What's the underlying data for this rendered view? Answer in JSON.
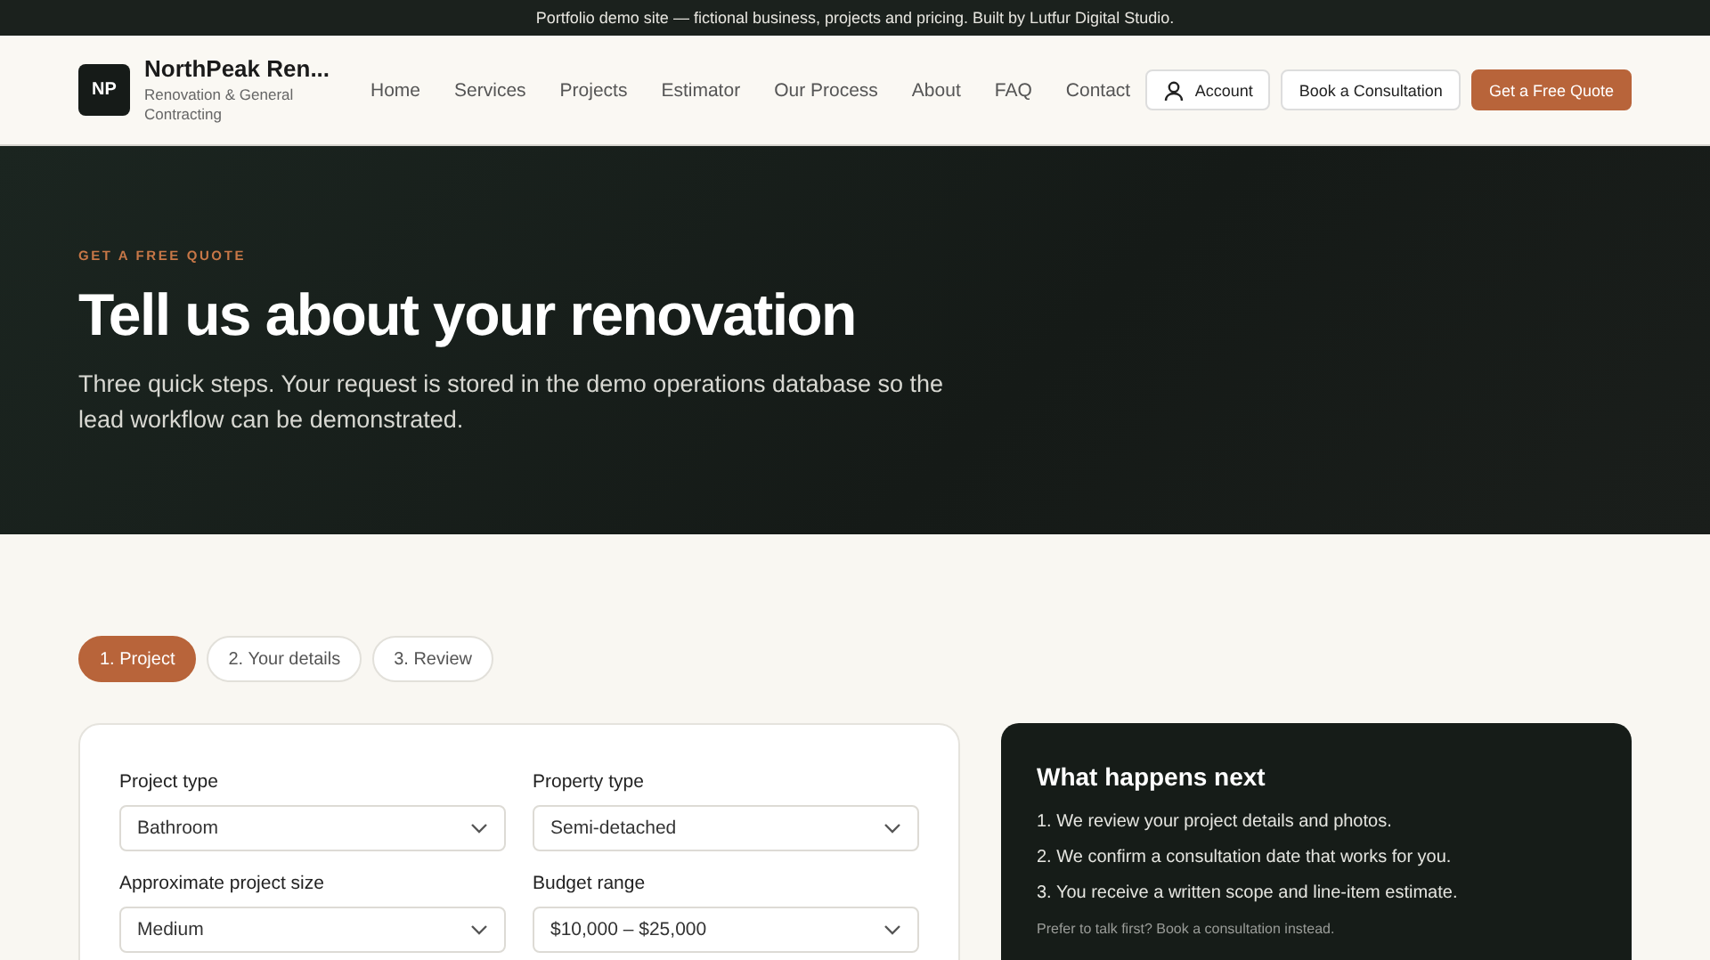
{
  "announcement": "Portfolio demo site — fictional business, projects and pricing. Built by Lutfur Digital Studio.",
  "brand": {
    "logo": "NP",
    "name": "NorthPeak Ren...",
    "tagline": "Renovation & General Contracting"
  },
  "nav": [
    "Home",
    "Services",
    "Projects",
    "Estimator",
    "Our Process",
    "About",
    "FAQ",
    "Contact"
  ],
  "header_buttons": [
    {
      "label": "Account",
      "kind": "account"
    },
    {
      "label": "Book a Consultation",
      "kind": "outline"
    },
    {
      "label": "Get a Free Quote",
      "kind": "primary"
    }
  ],
  "hero": {
    "eyebrow": "GET A FREE QUOTE",
    "title": "Tell us about your renovation",
    "subtitle": "Three quick steps. Your request is stored in the demo operations database so the lead workflow can be demonstrated."
  },
  "steps": [
    {
      "label": "1. Project",
      "selected": true
    },
    {
      "label": "2. Your details",
      "selected": false
    },
    {
      "label": "3. Review",
      "selected": false
    }
  ],
  "form_fields": [
    {
      "label": "Project type",
      "value": "Bathroom"
    },
    {
      "label": "Property type",
      "value": "Semi-detached"
    },
    {
      "label": "Approximate project size",
      "value": "Medium"
    },
    {
      "label": "Budget range",
      "value": "$10,000 – $25,000"
    }
  ],
  "next_panel": {
    "title": "What happens next",
    "items": [
      "1. We review your project details and photos.",
      "2. We confirm a consultation date that works for you.",
      "3. You receive a written scope and line-item estimate."
    ],
    "footer": "Prefer to talk first? Book a consultation instead."
  }
}
